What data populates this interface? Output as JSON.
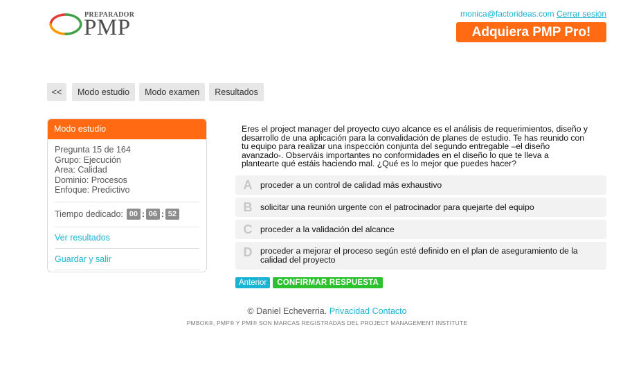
{
  "brand": {
    "logo_small": "PREPARADOR",
    "logo_big": "PMP",
    "logo_colors": {
      "red": "#e53935",
      "orange": "#ff9800",
      "green": "#43a047"
    }
  },
  "header": {
    "email": "monica@factorideas.com",
    "logout": "Cerrar sesión",
    "pro_button": "Adquiera PMP Pro!"
  },
  "nav": {
    "back": "<<",
    "study": "Modo estudio",
    "exam": "Modo examen",
    "results": "Resultados"
  },
  "sidebar": {
    "title": "Modo estudio",
    "question_counter": "Pregunta 15 de 164",
    "group": "Grupo: Ejecución",
    "area": "Area: Calidad",
    "domain": "Dominio: Procesos",
    "approach": "Enfoque: Predictivo",
    "time_label": "Tiempo dedicado:",
    "time": {
      "h": "00",
      "m": "06",
      "s": "52"
    },
    "view_results": "Ver resultados",
    "save_exit": "Guardar y salir"
  },
  "question": {
    "text": "Eres el project manager del proyecto cuyo alcance es el análisis de requerimientos, diseño y desarrollo de una aplicación para la convalidación de planes de estudio. Te has reunido con tu equipo para realizar una inspección conjunta del segundo entregable –el diseño avanzado-. Observáis importantes no conformidades en el diseño lo que te lleva a plantearte qué estáis haciendo mal. ¿Qué es lo mejor que puedes hacer?",
    "answers": [
      {
        "letter": "A",
        "text": "proceder a un control de calidad más exhaustivo"
      },
      {
        "letter": "B",
        "text": "solicitar una reunión urgente con el patrocinador para quejarte del equipo"
      },
      {
        "letter": "C",
        "text": "proceder a la validación del alcance"
      },
      {
        "letter": "D",
        "text": "proceder a mejorar el proceso según esté definido en el plan de aseguramiento de la calidad del proyecto"
      }
    ]
  },
  "actions": {
    "previous": "Anterior",
    "confirm": "CONFIRMAR RESPUESTA"
  },
  "footer": {
    "copyright": "© Daniel Echeverria.",
    "privacy": "Privacidad",
    "contact": "Contacto",
    "legal": "PMBOK®, PMP® Y PMI® SON MARCAS REGISTRADAS DEL PROJECT MANAGEMENT INSTITUTE"
  }
}
